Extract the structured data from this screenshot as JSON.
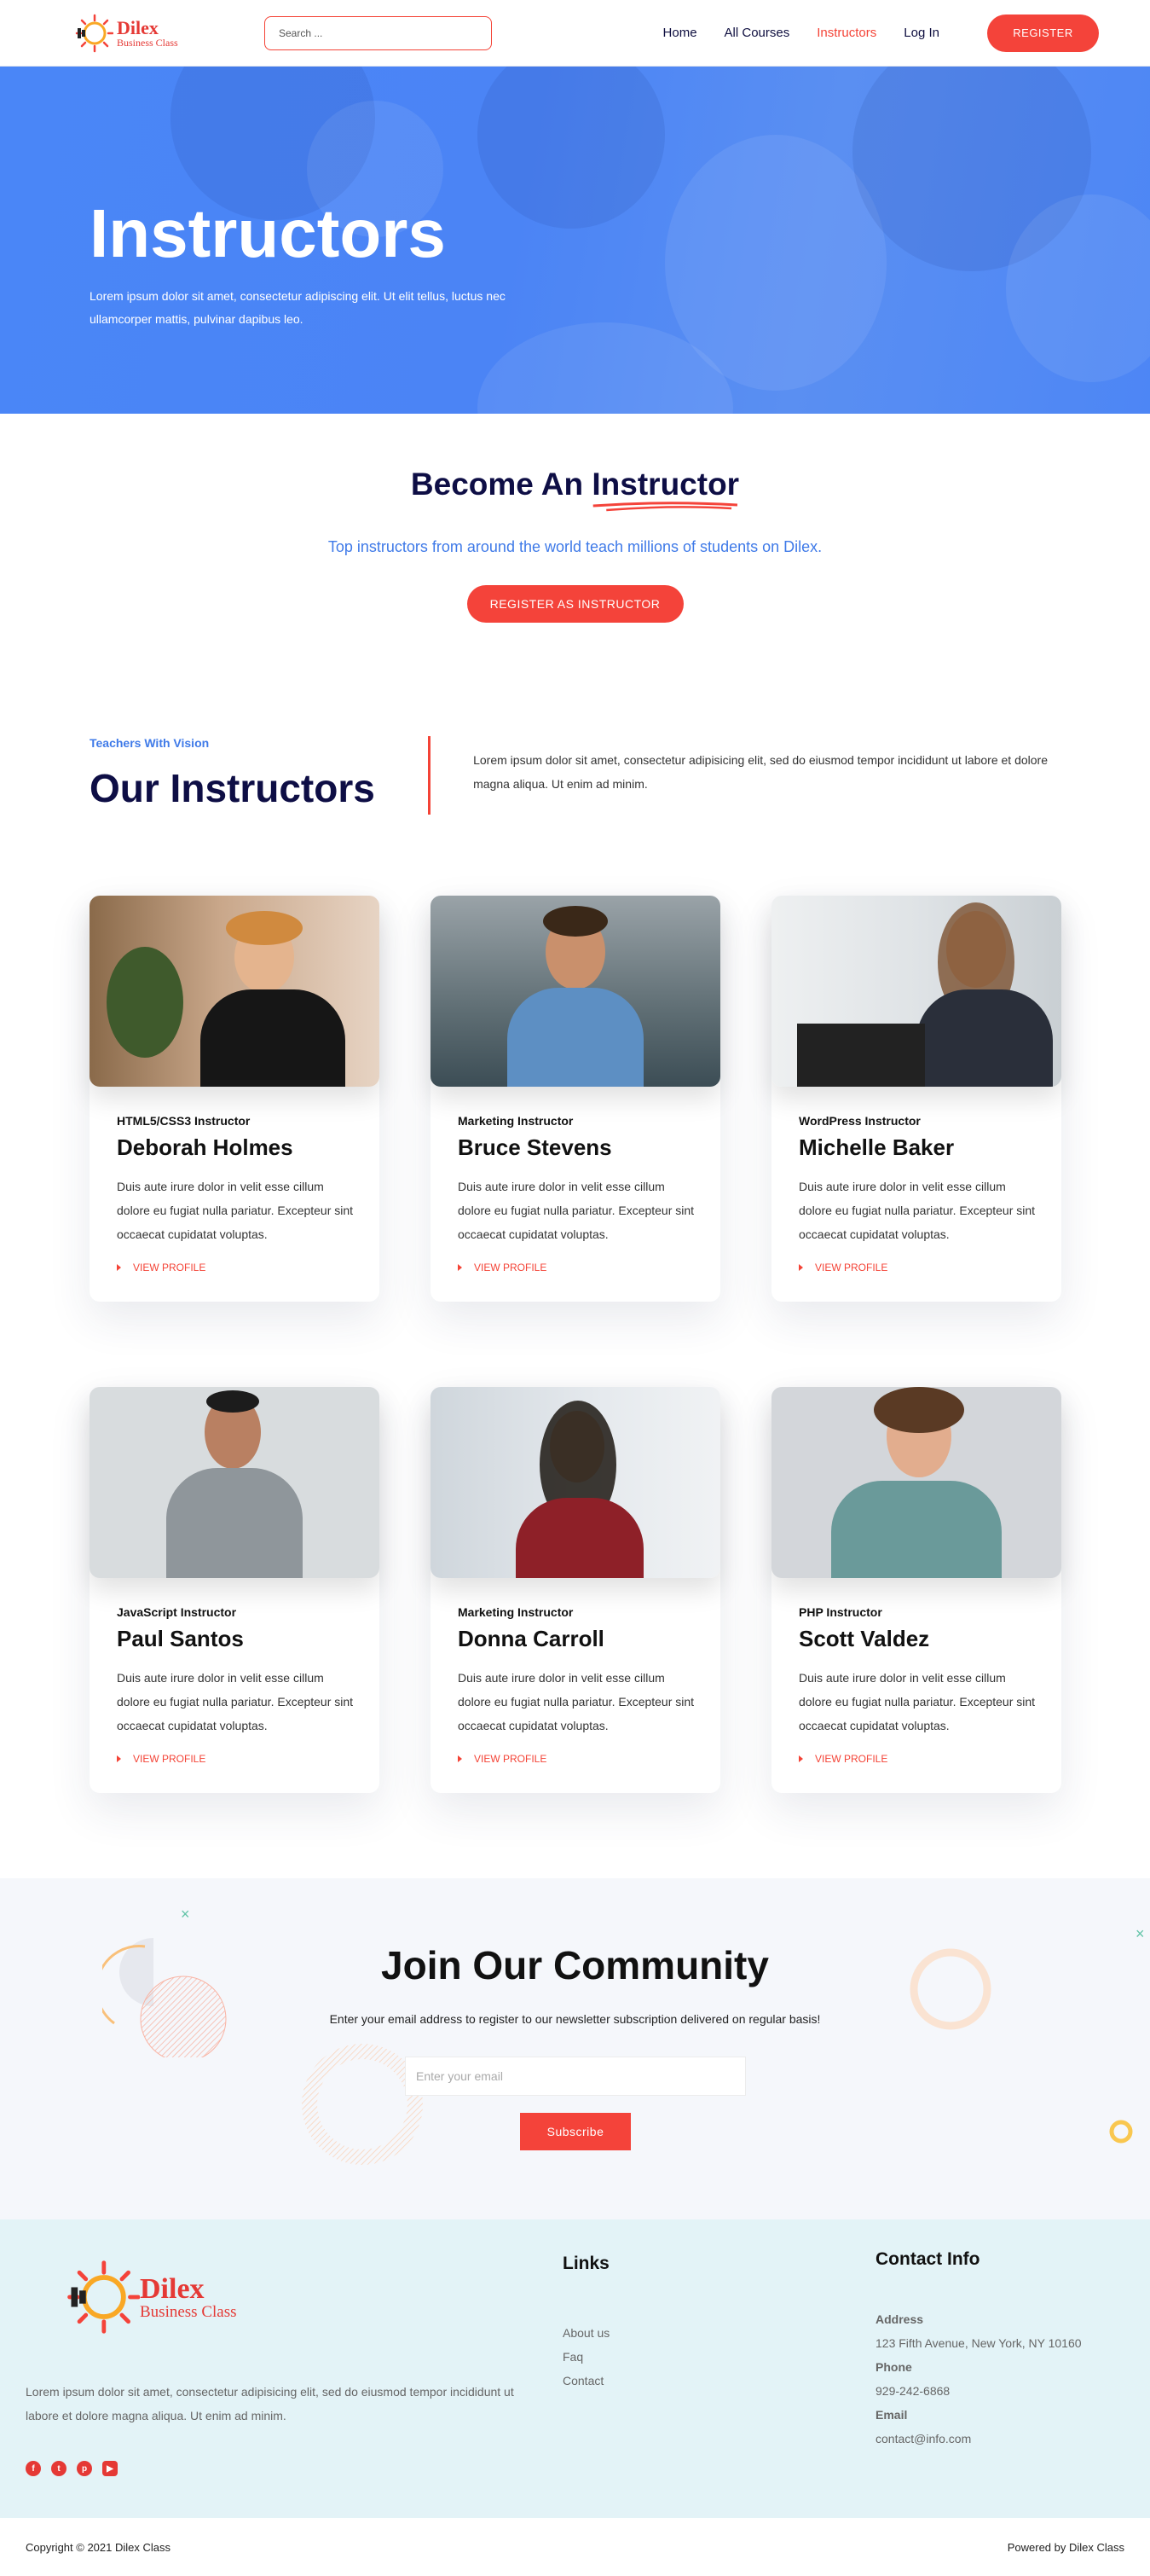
{
  "brand": {
    "name": "Dilex",
    "tagline": "Business Class",
    "accent": "#f4433a",
    "blue": "#4a86f7",
    "navy": "#0e0e45"
  },
  "header": {
    "search_placeholder": "Search ...",
    "nav": [
      {
        "label": "Home",
        "active": false
      },
      {
        "label": "All Courses",
        "active": false
      },
      {
        "label": "Instructors",
        "active": true
      },
      {
        "label": "Log In",
        "active": false
      }
    ],
    "register_label": "REGISTER"
  },
  "hero": {
    "title": "Instructors",
    "text": "Lorem ipsum dolor sit amet, consectetur adipiscing elit. Ut elit tellus, luctus nec ullamcorper mattis, pulvinar dapibus leo."
  },
  "become": {
    "title_prefix": "Become An",
    "title_highlight": "Instructor",
    "subtitle": "Top instructors from around the world teach millions of students on Dilex.",
    "button": "REGISTER AS INSTRUCTOR"
  },
  "our_instructors": {
    "eyebrow": "Teachers With Vision",
    "title": "Our Instructors",
    "text": "Lorem ipsum dolor sit amet, consectetur adipisicing elit, sed do eiusmod tempor incididunt ut labore et dolore magna aliqua. Ut enim ad minim."
  },
  "instructors": [
    {
      "role": "HTML5/CSS3 Instructor",
      "name": "Deborah Holmes",
      "text": "Duis aute irure dolor in velit esse cillum dolore eu fugiat nulla pariatur. Excepteur sint occaecat cupidatat voluptas.",
      "link": "VIEW PROFILE"
    },
    {
      "role": "Marketing Instructor",
      "name": "Bruce Stevens",
      "text": "Duis aute irure dolor in velit esse cillum dolore eu fugiat nulla pariatur. Excepteur sint occaecat cupidatat voluptas.",
      "link": "VIEW PROFILE"
    },
    {
      "role": "WordPress Instructor",
      "name": "Michelle Baker",
      "text": "Duis aute irure dolor in velit esse cillum dolore eu fugiat nulla pariatur. Excepteur sint occaecat cupidatat voluptas.",
      "link": "VIEW PROFILE"
    },
    {
      "role": "JavaScript Instructor",
      "name": "Paul Santos",
      "text": "Duis aute irure dolor in velit esse cillum dolore eu fugiat nulla pariatur. Excepteur sint occaecat cupidatat voluptas.",
      "link": "VIEW PROFILE"
    },
    {
      "role": "Marketing Instructor",
      "name": "Donna Carroll",
      "text": "Duis aute irure dolor in velit esse cillum dolore eu fugiat nulla pariatur. Excepteur sint occaecat cupidatat voluptas.",
      "link": "VIEW PROFILE"
    },
    {
      "role": "PHP Instructor",
      "name": "Scott Valdez",
      "text": "Duis aute irure dolor in velit esse cillum dolore eu fugiat nulla pariatur. Excepteur sint occaecat cupidatat voluptas.",
      "link": "VIEW PROFILE"
    }
  ],
  "community": {
    "title": "Join Our Community",
    "text": "Enter your email address to register to our newsletter subscription delivered on regular basis!",
    "email_placeholder": "Enter your email",
    "button": "Subscribe"
  },
  "footer": {
    "text": "Lorem ipsum dolor sit amet, consectetur adipisicing elit, sed do eiusmod tempor incididunt ut labore et dolore magna aliqua. Ut enim ad minim.",
    "social": [
      "facebook-icon",
      "twitter-icon",
      "pinterest-icon",
      "youtube-icon"
    ],
    "links_title": "Links",
    "links": [
      "About us",
      "Faq",
      "Contact"
    ],
    "contact_title": "Contact Info",
    "address_label": "Address",
    "address": "123 Fifth Avenue, New York, NY 10160",
    "phone_label": "Phone",
    "phone": "929-242-6868",
    "email_label": "Email",
    "email": "contact@info.com"
  },
  "copyright": {
    "left": "Copyright © 2021 Dilex Class",
    "right": "Powered by Dilex Class"
  }
}
